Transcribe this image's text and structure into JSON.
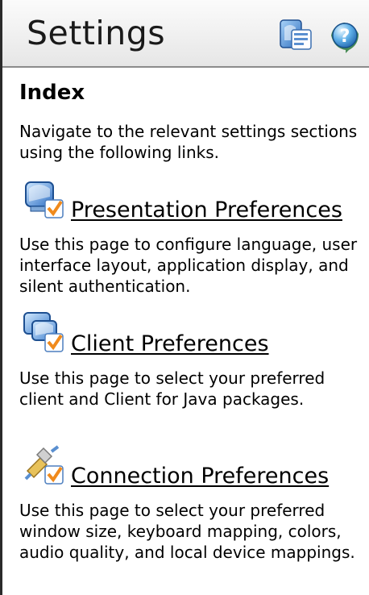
{
  "header": {
    "title": "Settings",
    "icons": [
      "settings-pages-icon",
      "help-icon"
    ]
  },
  "index": {
    "heading": "Index",
    "intro": "Navigate to the relevant settings sections using the following links."
  },
  "sections": [
    {
      "link": "Presentation Preferences",
      "description": "Use this page to configure language, user interface layout, application display, and silent authentication.",
      "icon": "presentation-preferences-icon"
    },
    {
      "link": "Client Preferences",
      "description": "Use this page to select your preferred client and Client for Java packages.",
      "icon": "client-preferences-icon"
    },
    {
      "link": "Connection Preferences",
      "description": "Use this page to select your preferred window size, keyboard mapping, colors, audio quality, and local device mappings.",
      "icon": "connection-preferences-icon"
    }
  ],
  "colors": {
    "header_bg": "#eeeeee",
    "border": "#2b2b2b",
    "icon_blue": "#4f8fd6",
    "check_orange": "#f08a1c"
  }
}
